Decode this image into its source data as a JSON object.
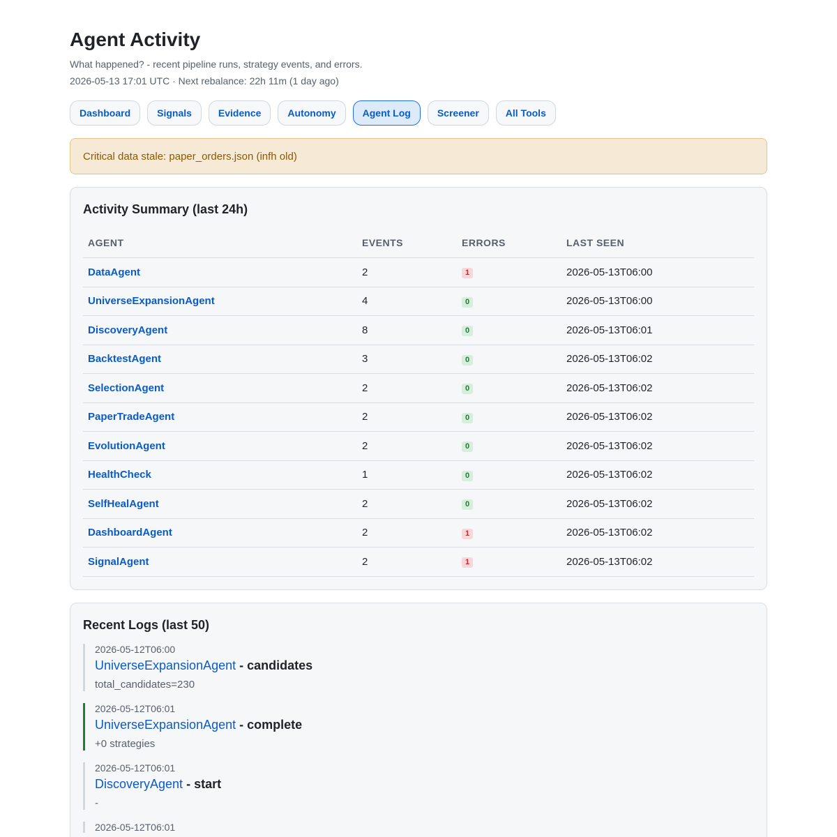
{
  "header": {
    "title": "Agent Activity",
    "subtitle": "What happened? - recent pipeline runs, strategy events, and errors.",
    "meta": "2026-05-13 17:01 UTC · Next rebalance: 22h 11m (1 day ago)"
  },
  "nav": [
    {
      "label": "Dashboard",
      "active": false
    },
    {
      "label": "Signals",
      "active": false
    },
    {
      "label": "Evidence",
      "active": false
    },
    {
      "label": "Autonomy",
      "active": false
    },
    {
      "label": "Agent Log",
      "active": true
    },
    {
      "label": "Screener",
      "active": false
    },
    {
      "label": "All Tools",
      "active": false
    }
  ],
  "alert": {
    "text": "Critical data stale: paper_orders.json (infh old)"
  },
  "summary": {
    "title": "Activity Summary (last 24h)",
    "columns": [
      "AGENT",
      "EVENTS",
      "ERRORS",
      "LAST SEEN"
    ],
    "rows": [
      {
        "agent": "DataAgent",
        "events": "2",
        "errors": "1",
        "last_seen": "2026-05-13T06:00"
      },
      {
        "agent": "UniverseExpansionAgent",
        "events": "4",
        "errors": "0",
        "last_seen": "2026-05-13T06:00"
      },
      {
        "agent": "DiscoveryAgent",
        "events": "8",
        "errors": "0",
        "last_seen": "2026-05-13T06:01"
      },
      {
        "agent": "BacktestAgent",
        "events": "3",
        "errors": "0",
        "last_seen": "2026-05-13T06:02"
      },
      {
        "agent": "SelectionAgent",
        "events": "2",
        "errors": "0",
        "last_seen": "2026-05-13T06:02"
      },
      {
        "agent": "PaperTradeAgent",
        "events": "2",
        "errors": "0",
        "last_seen": "2026-05-13T06:02"
      },
      {
        "agent": "EvolutionAgent",
        "events": "2",
        "errors": "0",
        "last_seen": "2026-05-13T06:02"
      },
      {
        "agent": "HealthCheck",
        "events": "1",
        "errors": "0",
        "last_seen": "2026-05-13T06:02"
      },
      {
        "agent": "SelfHealAgent",
        "events": "2",
        "errors": "0",
        "last_seen": "2026-05-13T06:02"
      },
      {
        "agent": "DashboardAgent",
        "events": "2",
        "errors": "1",
        "last_seen": "2026-05-13T06:02"
      },
      {
        "agent": "SignalAgent",
        "events": "2",
        "errors": "1",
        "last_seen": "2026-05-13T06:02"
      }
    ]
  },
  "logs": {
    "title": "Recent Logs (last 50)",
    "separator": " - ",
    "entries": [
      {
        "time": "2026-05-12T06:00",
        "agent": "UniverseExpansionAgent",
        "event": "candidates",
        "detail": "total_candidates=230",
        "status": "info"
      },
      {
        "time": "2026-05-12T06:01",
        "agent": "UniverseExpansionAgent",
        "event": "complete",
        "detail": "+0 strategies",
        "status": "complete"
      },
      {
        "time": "2026-05-12T06:01",
        "agent": "DiscoveryAgent",
        "event": "start",
        "detail": "-",
        "status": "info"
      },
      {
        "time": "2026-05-12T06:01",
        "agent": "",
        "event": "",
        "detail": "",
        "status": "info"
      }
    ]
  },
  "colors": {
    "link": "#0a5bc4",
    "error_badge_bg": "#f8d7da",
    "ok_badge_bg": "#d7eedc",
    "alert_bg": "#f6ead6",
    "complete_border": "#1a7f37"
  }
}
